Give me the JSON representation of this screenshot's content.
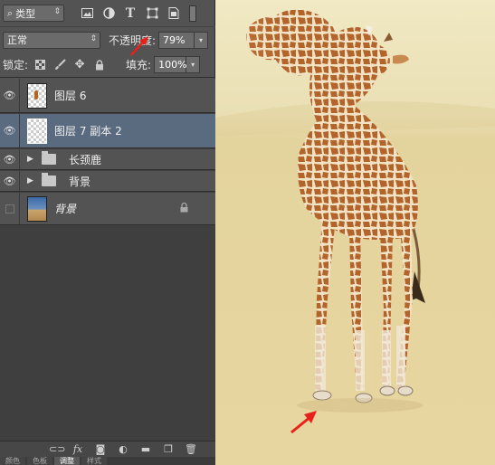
{
  "layers_panel": {
    "filter_kind": "类型",
    "blend_mode": "正常",
    "opacity_label": "不透明度:",
    "opacity_value": "79%",
    "lock_label": "锁定:",
    "fill_label": "填充:",
    "fill_value": "100%",
    "layers": [
      {
        "name": "图层 6",
        "type": "layer",
        "visible": true,
        "selected": false
      },
      {
        "name": "图层 7 副本 2",
        "type": "layer",
        "visible": true,
        "selected": true
      },
      {
        "name": "长颈鹿",
        "type": "group",
        "visible": true,
        "selected": false
      },
      {
        "name": "背景",
        "type": "group",
        "visible": true,
        "selected": false
      },
      {
        "name": "背景",
        "type": "background",
        "visible": false,
        "selected": false,
        "locked": true
      }
    ],
    "bottom_tabs": [
      "颜色",
      "色板",
      "调整",
      "样式"
    ],
    "active_tab": "调整"
  },
  "icons": {
    "search": "search-icon",
    "filter_pixel": "image-filter-icon",
    "filter_adjust": "adjustment-filter-icon",
    "filter_text": "text-filter-icon",
    "filter_shape": "shape-filter-icon",
    "filter_smart": "smart-object-filter-icon",
    "lock_transparent": "lock-transparent-icon",
    "lock_paint": "brush-icon",
    "lock_move": "move-icon",
    "lock_all": "lock-icon",
    "link": "link-icon",
    "fx": "fx-icon",
    "mask": "mask-icon",
    "adjust": "adjustment-layer-icon",
    "folder": "folder-icon",
    "new_layer": "new-layer-icon",
    "delete": "trash-icon"
  },
  "colors": {
    "selected_layer": "#5a6b80",
    "annotation_arrow": "#e8221b",
    "canvas_bg": "#ece2b7"
  }
}
